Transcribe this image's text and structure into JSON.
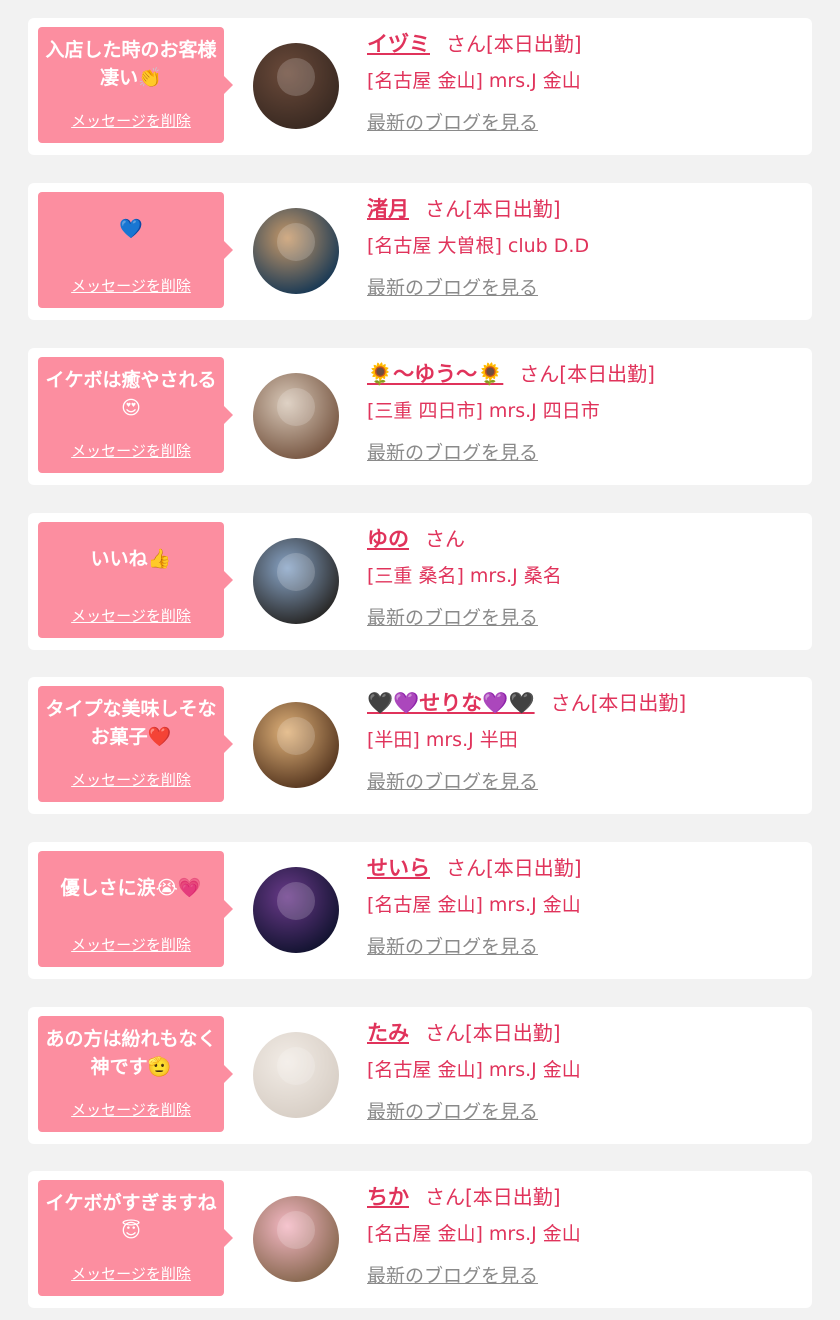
{
  "messages": [
    {
      "text": "入店した時のお客様凄い👏",
      "delete_label": "メッセージを削除",
      "name": "イヅミ",
      "suffix": "さん[本日出勤]",
      "shop": "[名古屋 金山] mrs.J 金山",
      "blog_link": "最新のブログを見る",
      "avatar_colors": [
        "#3a2a22",
        "#6b4a3a"
      ]
    },
    {
      "text": "💙",
      "delete_label": "メッセージを削除",
      "name": "渚月",
      "suffix": "さん[本日出勤]",
      "shop": "[名古屋 大曽根] club D.D",
      "blog_link": "最新のブログを見る",
      "avatar_colors": [
        "#1d3b55",
        "#c89a6a"
      ]
    },
    {
      "text": "イケボは癒やされる😍",
      "delete_label": "メッセージを削除",
      "name": "🌻～ゆう～🌻",
      "suffix": "さん[本日出勤]",
      "shop": "[三重 四日市] mrs.J 四日市",
      "blog_link": "最新のブログを見る",
      "avatar_colors": [
        "#7a5a46",
        "#d8c8b8"
      ]
    },
    {
      "text": "いいね👍",
      "delete_label": "メッセージを削除",
      "name": "ゆの",
      "suffix": "さん",
      "shop": "[三重 桑名] mrs.J 桑名",
      "blog_link": "最新のブログを見る",
      "avatar_colors": [
        "#2a2a2a",
        "#8aa6c8"
      ]
    },
    {
      "text": "タイプな美味しそなお菓子❤️",
      "delete_label": "メッセージを削除",
      "name": "🖤💜せりな💜🖤",
      "suffix": "さん[本日出勤]",
      "shop": "[半田] mrs.J 半田",
      "blog_link": "最新のブログを見る",
      "avatar_colors": [
        "#5a3a22",
        "#e0b27a"
      ]
    },
    {
      "text": "優しさに涙😭💗",
      "delete_label": "メッセージを削除",
      "name": "せいら",
      "suffix": "さん[本日出勤]",
      "shop": "[名古屋 金山] mrs.J 金山",
      "blog_link": "最新のブログを見る",
      "avatar_colors": [
        "#141432",
        "#6a3a8a"
      ]
    },
    {
      "text": "あの方は紛れもなく神です🫡",
      "delete_label": "メッセージを削除",
      "name": "たみ",
      "suffix": "さん[本日出勤]",
      "shop": "[名古屋 金山] mrs.J 金山",
      "blog_link": "最新のブログを見る",
      "avatar_colors": [
        "#d8cfc6",
        "#f2ece6"
      ]
    },
    {
      "text": "イケボがすぎますね😇",
      "delete_label": "メッセージを削除",
      "name": "ちか",
      "suffix": "さん[本日出勤]",
      "shop": "[名古屋 金山] mrs.J 金山",
      "blog_link": "最新のブログを見る",
      "avatar_colors": [
        "#8a6a52",
        "#f4b8c4"
      ]
    }
  ]
}
